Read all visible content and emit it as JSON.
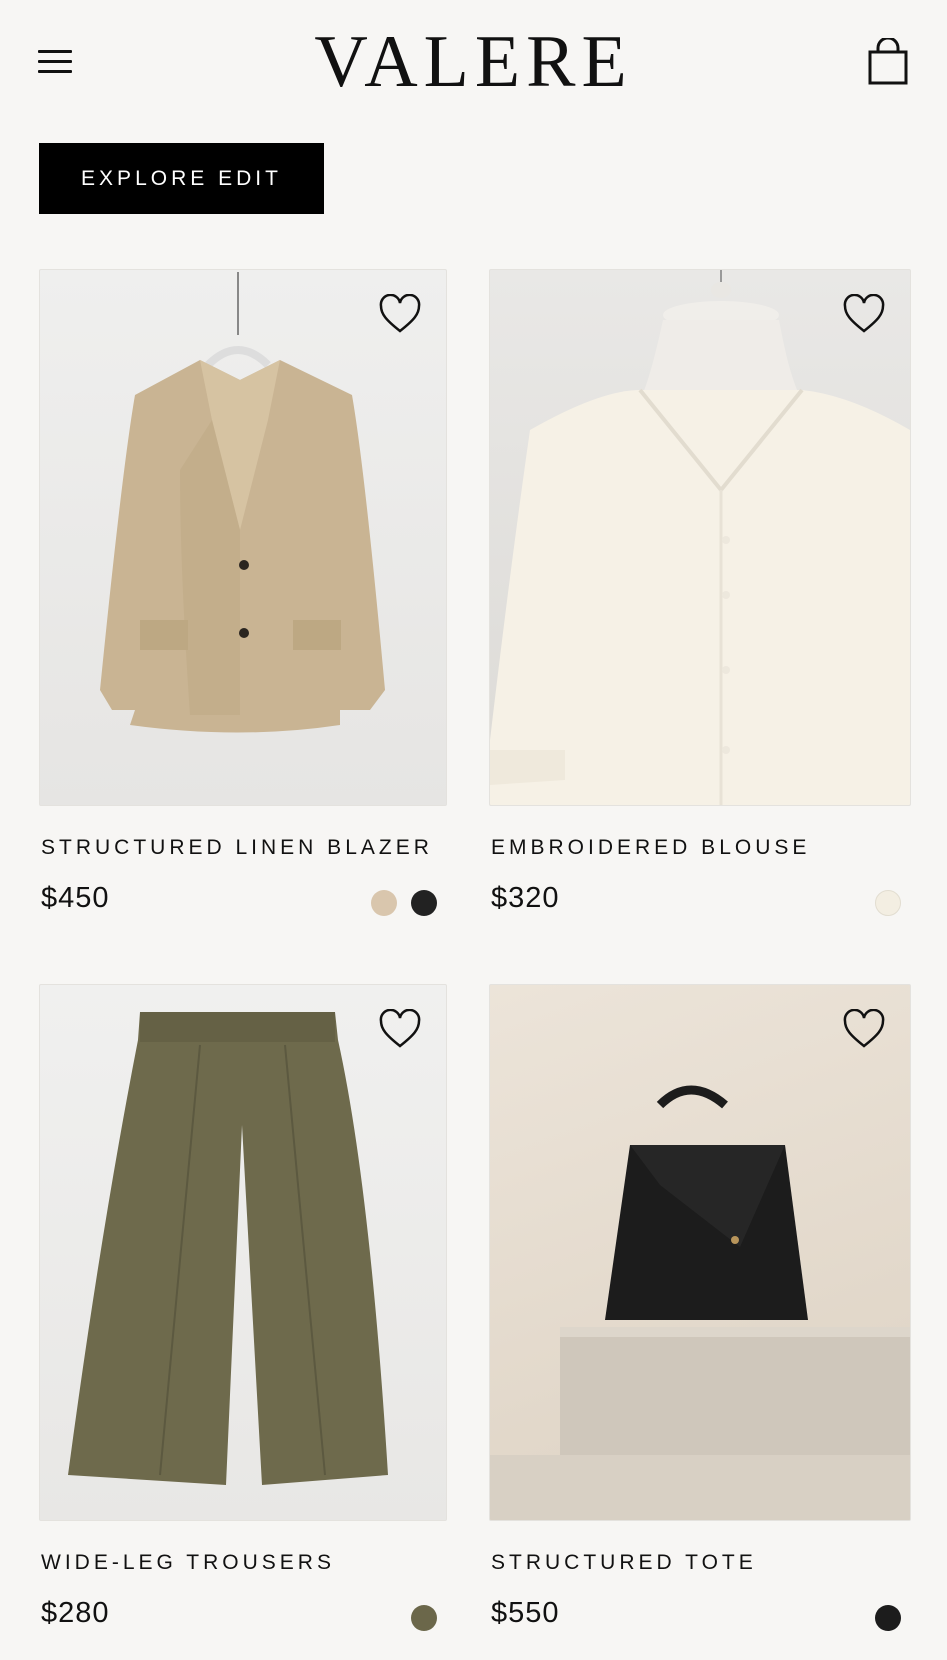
{
  "brand": "VALERE",
  "cta": {
    "label": "EXPLORE EDIT"
  },
  "colors": {
    "background": "#f7f6f4",
    "cta_bg": "#000000",
    "text": "#111111"
  },
  "icons": {
    "menu": "hamburger-menu-icon",
    "bag": "shopping-bag-icon",
    "favorite": "heart-outline-icon"
  },
  "products": [
    {
      "name": "STRUCTURED LINEN BLAZER",
      "price": "$450",
      "swatches": [
        "#d9c6ad",
        "#222222"
      ]
    },
    {
      "name": "EMBROIDERED BLOUSE",
      "price": "$320",
      "swatches": [
        "#f3eee2"
      ]
    },
    {
      "name": "WIDE-LEG TROUSERS",
      "price": "$280",
      "swatches": [
        "#6b674a"
      ]
    },
    {
      "name": "STRUCTURED TOTE",
      "price": "$550",
      "swatches": [
        "#1c1c1c"
      ]
    }
  ]
}
